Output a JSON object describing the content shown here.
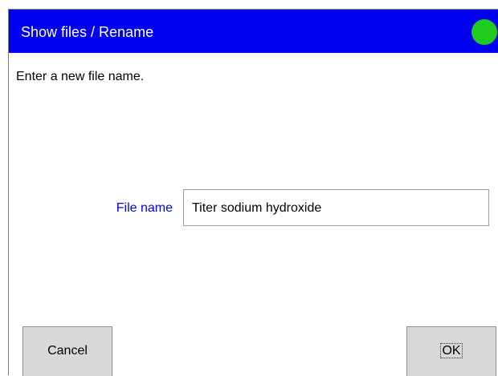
{
  "window": {
    "title": "Show files / Rename",
    "status_color": "#1ecb1e",
    "status_icon": "status-indicator-icon"
  },
  "dialog": {
    "instruction": "Enter a new file name.",
    "file_name_label": "File name",
    "file_name_value": "Titer sodium hydroxide"
  },
  "buttons": {
    "cancel_label": "Cancel",
    "ok_label": "OK"
  }
}
